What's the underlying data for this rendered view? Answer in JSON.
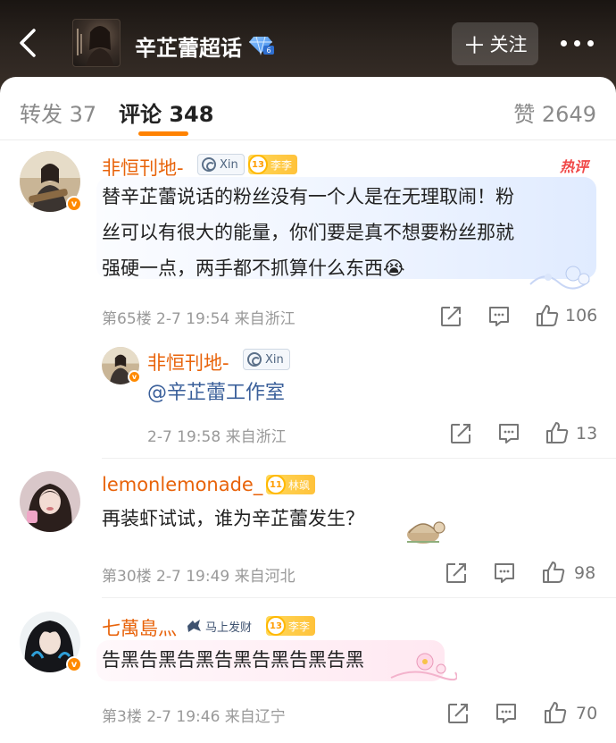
{
  "header": {
    "title": "辛芷蕾超话",
    "follow_label": "关注",
    "follow_plus": "＋"
  },
  "tabs": {
    "repost": "转发 37",
    "comment": "评论 348",
    "like": "赞 2649"
  },
  "comments": [
    {
      "username": "非恒刊地-",
      "xin_badge": "Xin",
      "fan_level": "13",
      "fan_name": "李李",
      "hot_label": "热评",
      "text_lines": [
        "替辛芷蕾说话的粉丝没有一个人是在无理取闹！粉",
        "丝可以有很大的能量，你们要是真不想要粉丝那就",
        "强硬一点，两手都不抓算什么东西😭"
      ],
      "meta": "第65楼 2-7 19:54 来自浙江",
      "likes": "106",
      "reply": {
        "username": "非恒刊地-",
        "xin_badge": "Xin",
        "text": "@辛芷蕾工作室",
        "meta": "2-7 19:58 来自浙江",
        "likes": "13"
      }
    },
    {
      "username": "lemonlemonade_",
      "fan_level": "11",
      "fan_name": "林飒",
      "text": "再装虾试试，谁为辛芷蕾发生？",
      "meta": "第30楼 2-7 19:49 来自河北",
      "likes": "98"
    },
    {
      "username": "七萬島灬",
      "title_badge": "马上发财",
      "fan_level": "13",
      "fan_name": "李李",
      "text": "告黑告黑告黑告黑告黑告黑告黑",
      "meta": "第3楼 2-7 19:46 来自辽宁",
      "likes": "70"
    }
  ],
  "colors": {
    "accent": "#ff8200",
    "username": "#e8630a",
    "hot": "#f04848"
  }
}
